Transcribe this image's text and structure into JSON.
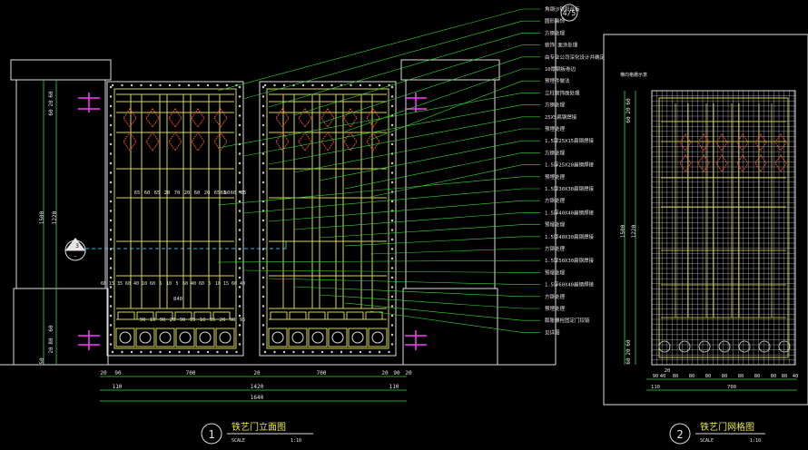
{
  "top_circle_label": "4/5",
  "gate_view": {
    "title": "铁艺门立面图",
    "number": "1",
    "scale_label": "SCALE",
    "scale_value": "1:10",
    "section_marker": "3",
    "left_dims": [
      "60",
      "20",
      "60",
      "1500",
      "1220",
      "60",
      "80",
      "20",
      "50"
    ],
    "bottom_dims_row1": [
      "20",
      "90",
      "700",
      "20",
      "700",
      "20",
      "90",
      "20"
    ],
    "bottom_dims_row2": [
      "110",
      "1420",
      "110"
    ],
    "bottom_dims_row3": [
      "1640"
    ],
    "inner_dims_upper_left": [
      "65",
      "60",
      "65",
      "20",
      "70",
      "20",
      "60",
      "20",
      "65",
      "60"
    ],
    "inner_dims_upper_right": [
      "65",
      "60",
      "65"
    ],
    "inner_dims_mid_left": [
      "90",
      "10",
      "90",
      "20",
      "90",
      "95",
      "10",
      "95",
      "20",
      "90",
      "95"
    ],
    "inner_dims_840": "840",
    "inner_dims_lower": [
      "60",
      "15",
      "35",
      "60",
      "40",
      "10",
      "60",
      "5",
      "10",
      "5",
      "60",
      "40",
      "60",
      "5",
      "10",
      "15",
      "60",
      "40"
    ],
    "callouts": [
      "角钢沙铁阳台板",
      "圆形装饰",
      "方钢处理",
      "装饰 面涂处理",
      "由专业公司深化设计并确定",
      "10厚钢板卷边",
      "预埋件做法",
      "立柱装饰面处理",
      "方钢处理",
      "25X5扁钢焊接",
      "预埋处理",
      "1.5厚25X15扁钢焊接",
      "方钢处理",
      "1.5厚25X20扁钢焊接",
      "预埋处理",
      "1.5厚30X30扁钢焊接",
      "方钢处理",
      "1.5厚40X40扁钢焊接",
      "预埋处理",
      "1.5厚40X30扁钢焊接",
      "方钢处理",
      "1.5厚50X30扁钢焊接",
      "预埋处理",
      "1.5厚60X40扁钢焊接",
      "方钢处理",
      "预埋处理",
      "膨胀螺栓固定门铰链",
      "见详图"
    ]
  },
  "grid_view": {
    "title": "铁艺门网格图",
    "number": "2",
    "scale_label": "SCALE",
    "scale_value": "1:10",
    "top_label": "横向格栅示意",
    "left_dims": [
      "60",
      "20",
      "60",
      "1500",
      "1220",
      "60",
      "20",
      "60"
    ],
    "bottom_dims_row1": [
      "20",
      "90",
      "40",
      "80",
      "80",
      "80",
      "80",
      "80",
      "80",
      "80",
      "80",
      "40"
    ],
    "bottom_dims_row2": [
      "110",
      "700"
    ]
  }
}
